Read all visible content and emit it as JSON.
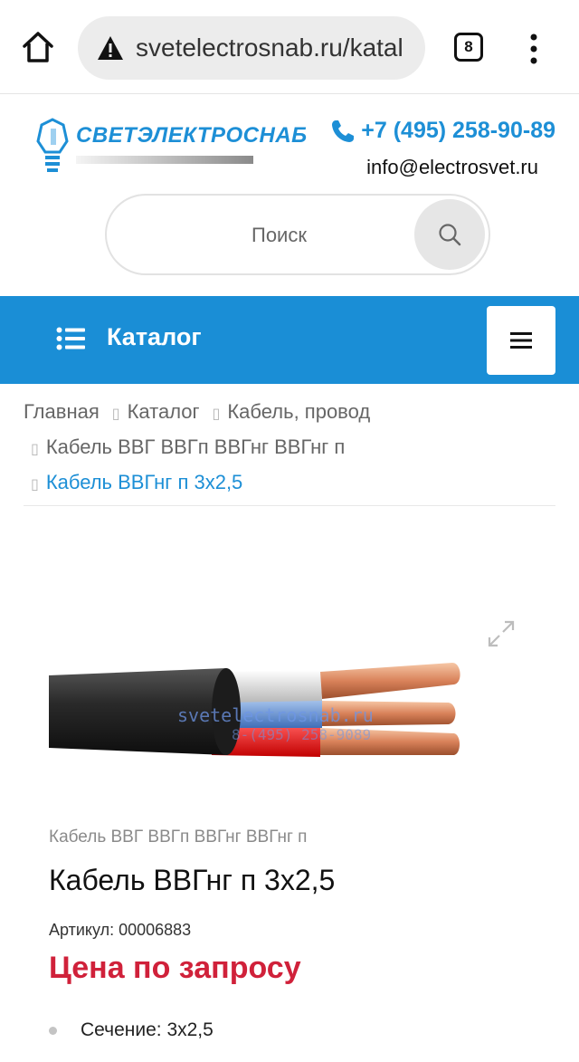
{
  "browser": {
    "url": "svetelectrosnab.ru/katal",
    "tab_count": "8"
  },
  "site": {
    "logo_text": "СВЕТЭЛЕКТРОСНАБ",
    "phone": "+7 (495) 258-90-89",
    "email": "info@electrosvet.ru"
  },
  "search": {
    "placeholder": "Поиск"
  },
  "catalog_bar": {
    "label": "Каталог"
  },
  "breadcrumbs": {
    "items": [
      "Главная",
      "Каталог",
      "Кабель, провод",
      "Кабель ВВГ ВВГп ВВГнг ВВГнг п",
      "Кабель ВВГнг п 3х2,5"
    ]
  },
  "product": {
    "watermark_site": "svetelectrosnab.ru",
    "watermark_phone": "8-(495) 258-9089",
    "category": "Кабель ВВГ ВВГп ВВГнг ВВГнг п",
    "title": "Кабель ВВГнг п 3х2,5",
    "sku": "Артикул: 00006883",
    "price": "Цена по запросу",
    "specs": [
      "Сечение: 3х2,5"
    ]
  },
  "colors": {
    "brand_blue": "#1a8ed6",
    "price_red": "#d0213a"
  }
}
